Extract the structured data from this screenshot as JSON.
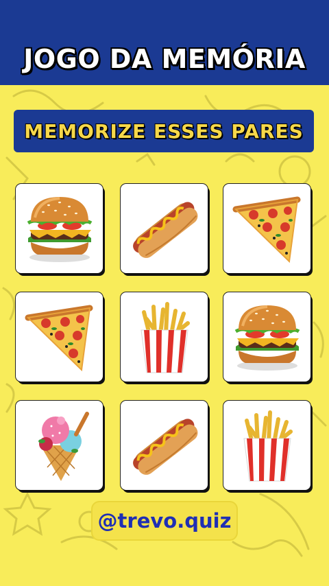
{
  "header": {
    "title": "JOGO DA MEMÓRIA"
  },
  "instruction": {
    "label": "MEMORIZE ESSES PARES"
  },
  "cards": [
    {
      "food": "burger"
    },
    {
      "food": "hotdog"
    },
    {
      "food": "pizza"
    },
    {
      "food": "pizza"
    },
    {
      "food": "fries"
    },
    {
      "food": "burger"
    },
    {
      "food": "icecream"
    },
    {
      "food": "hotdog"
    },
    {
      "food": "fries"
    }
  ],
  "footer": {
    "handle": "@trevo.quiz"
  },
  "colors": {
    "background": "#f8ec5a",
    "banner": "#1b3a93",
    "subtitle_text": "#f6d84a",
    "handle_text": "#1f2fb4"
  }
}
